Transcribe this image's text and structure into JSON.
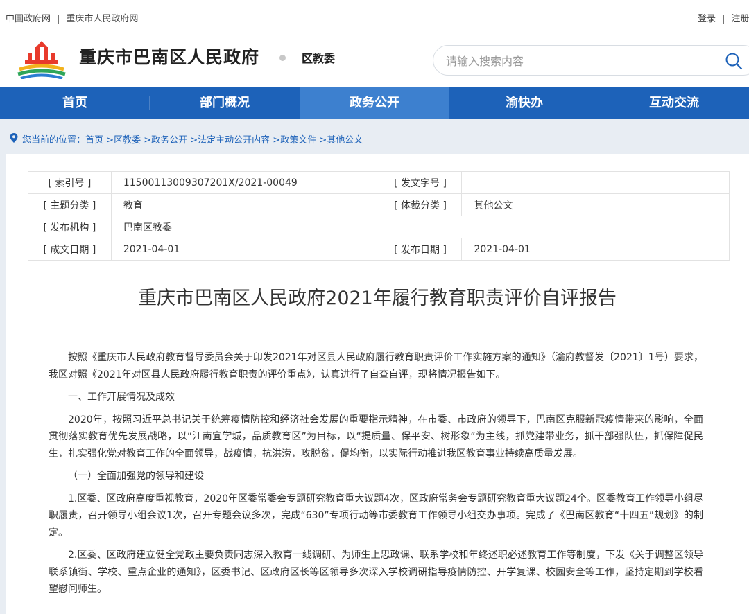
{
  "topbar": {
    "left_links": [
      "中国政府网",
      "重庆市人民政府网"
    ],
    "right_links": [
      "登录",
      "注册"
    ]
  },
  "header": {
    "site_title": "重庆市巴南区人民政府",
    "dept": "区教委",
    "search_placeholder": "请输入搜索内容"
  },
  "nav": {
    "items": [
      "首页",
      "部门概况",
      "政务公开",
      "渝快办",
      "互动交流"
    ],
    "active_index": 2
  },
  "breadcrumb": {
    "prefix": "您当前的位置：",
    "items": [
      "首页",
      "区教委",
      "政务公开",
      "法定主动公开内容",
      "政策文件",
      "其他公文"
    ],
    "separator": " >"
  },
  "meta": {
    "index_label": "[ 索引号 ]",
    "index_value": "11500113009307201X/2021-00049",
    "doc_no_label": "[ 发文字号 ]",
    "doc_no_value": "",
    "topic_label": "[ 主题分类 ]",
    "topic_value": "教育",
    "genre_label": "[ 体裁分类 ]",
    "genre_value": "其他公文",
    "org_label": "[ 发布机构 ]",
    "org_value": "巴南区教委",
    "created_label": "[ 成文日期 ]",
    "created_value": "2021-04-01",
    "published_label": "[ 发布日期 ]",
    "published_value": "2021-04-01"
  },
  "document": {
    "title": "重庆市巴南区人民政府2021年履行教育职责评价自评报告",
    "paragraphs": [
      "按照《重庆市人民政府教育督导委员会关于印发2021年对区县人民政府履行教育职责评价工作实施方案的通知》（渝府教督发〔2021〕1号）要求，我区对照《2021年对区县人民政府履行教育职责的评价重点》，认真进行了自查自评，现将情况报告如下。",
      "一、工作开展情况及成效",
      "2020年，按照习近平总书记关于统筹疫情防控和经济社会发展的重要指示精神，在市委、市政府的领导下，巴南区克服新冠疫情带来的影响，全面贯彻落实教育优先发展战略，以“江南宜学城，品质教育区”为目标，以“提质量、保平安、树形象”为主线，抓党建带业务，抓干部强队伍，抓保障促民生，扎实强化党对教育工作的全面领导，战疫情，抗洪涝，攻脱贫，促均衡，以实际行动推进我区教育事业持续高质量发展。",
      "（一）全面加强党的领导和建设",
      "1.区委、区政府高度重视教育，2020年区委常委会专题研究教育重大议题4次，区政府常务会专题研究教育重大议题24个。区委教育工作领导小组尽职履责，召开领导小组会议1次，召开专题会议多次，完成“630”专项行动等市委教育工作领导小组交办事项。完成了《巴南区教育“十四五”规划》的制定。",
      "2.区委、区政府建立健全党政主要负责同志深入教育一线调研、为师生上思政课、联系学校和年终述职必述教育工作等制度，下发《关于调整区领导联系镇街、学校、重点企业的通知》，区委书记、区政府区长等区领导多次深入学校调研指导疫情防控、开学复课、校园安全等工作，坚持定期到学校看望慰问师生。"
    ]
  },
  "colors": {
    "nav_bg": "#1d62b9",
    "nav_active": "#3d80cf",
    "page_bg": "#e8edf3"
  }
}
